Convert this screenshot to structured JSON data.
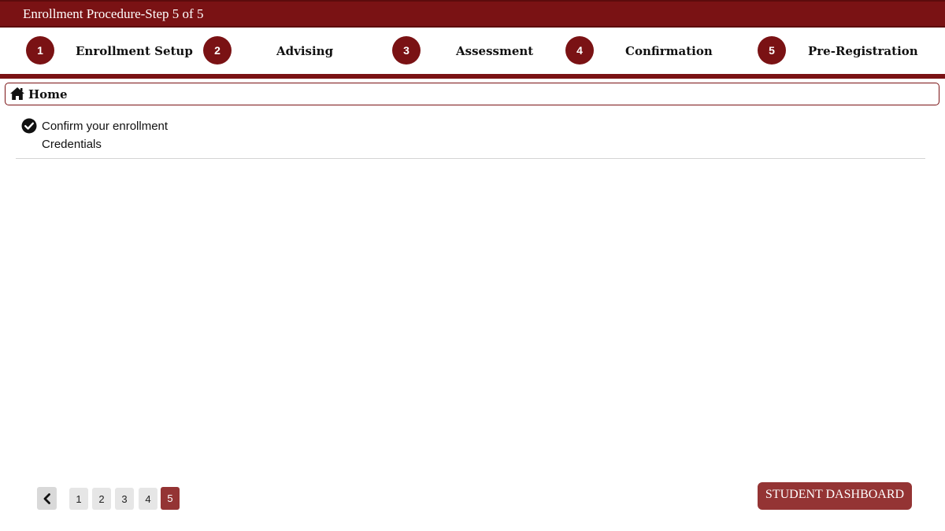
{
  "header": {
    "title": "Enrollment Procedure-Step 5 of 5"
  },
  "steps": [
    {
      "number": "1",
      "label": "Enrollment Setup"
    },
    {
      "number": "2",
      "label": "Advising"
    },
    {
      "number": "3",
      "label": "Assessment"
    },
    {
      "number": "4",
      "label": "Confirmation"
    },
    {
      "number": "5",
      "label": "Pre-Registration"
    }
  ],
  "breadcrumb": {
    "home_label": "Home",
    "icon": "home-icon"
  },
  "content": {
    "confirm_text": "Confirm your enrollment",
    "credentials_text": "Credentials",
    "icon": "check-circle-icon"
  },
  "pagination": {
    "prev_icon": "chevron-left-icon",
    "pages": [
      "1",
      "2",
      "3",
      "4",
      "5"
    ],
    "current_page": "5"
  },
  "actions": {
    "dashboard_label": "STUDENT DASHBOARD"
  },
  "colors": {
    "brand": "#7a1214",
    "button": "#943434",
    "page_button": "#e6e6e6"
  }
}
